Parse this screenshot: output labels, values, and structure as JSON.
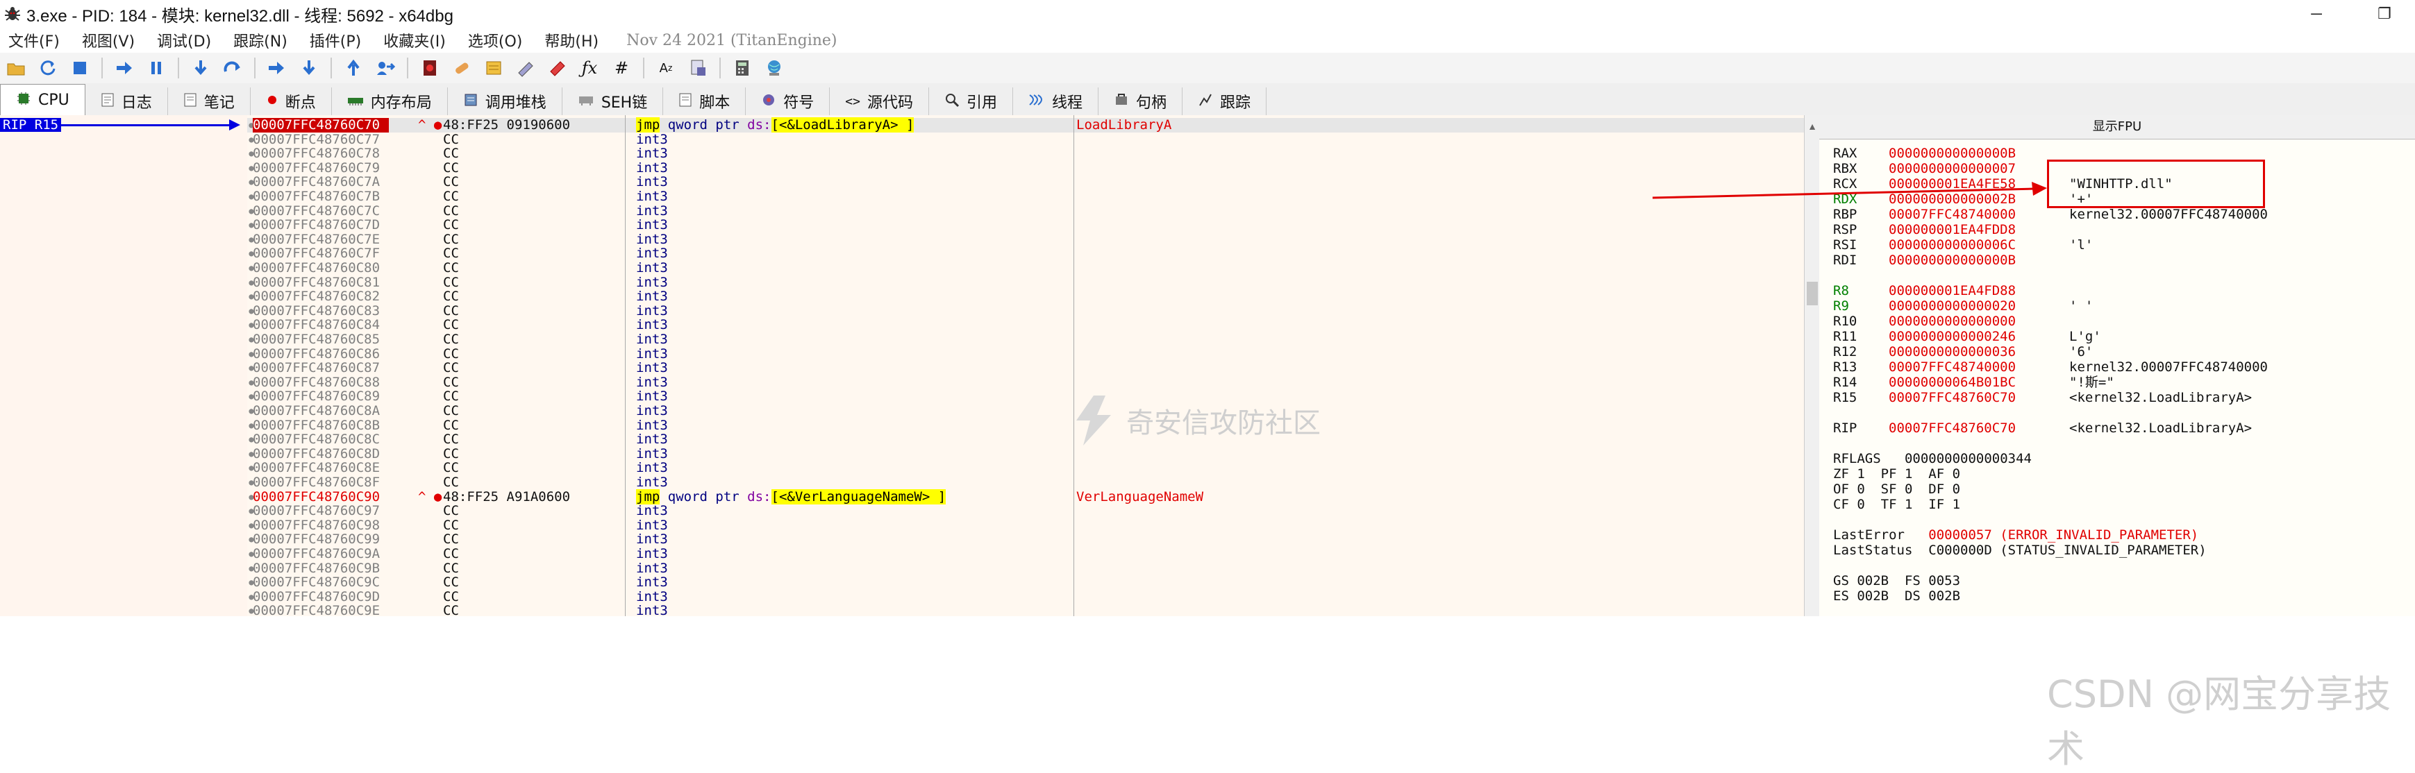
{
  "window": {
    "title": "3.exe - PID: 184 - 模块: kernel32.dll - 线程: 5692 - x64dbg",
    "controls": {
      "minimize": "─",
      "restore": "❐"
    }
  },
  "menu": {
    "items": [
      "文件(F)",
      "视图(V)",
      "调试(D)",
      "跟踪(N)",
      "插件(P)",
      "收藏夹(I)",
      "选项(O)",
      "帮助(H)"
    ],
    "build_date": "Nov 24 2021 (TitanEngine)"
  },
  "toolbar": {
    "icons": [
      "open-icon",
      "restart-icon",
      "stop-icon",
      "run-icon",
      "pause-icon",
      "step-into-icon",
      "step-over-icon",
      "trace-into-icon",
      "trace-over-icon",
      "execute-till-return-icon",
      "run-to-user-code-icon",
      "record-icon",
      "patch-icon",
      "comment-icon",
      "label-icon",
      "bookmark-icon",
      "function-icon",
      "hash-icon",
      "font-icon",
      "strings-icon",
      "calculator-icon",
      "globe-icon"
    ]
  },
  "tabs": [
    {
      "label": "CPU",
      "icon": "cpu-icon",
      "active": true
    },
    {
      "label": "日志",
      "icon": "log-icon"
    },
    {
      "label": "笔记",
      "icon": "notes-icon"
    },
    {
      "label": "断点",
      "icon": "breakpoint-icon"
    },
    {
      "label": "内存布局",
      "icon": "memory-icon"
    },
    {
      "label": "调用堆栈",
      "icon": "callstack-icon"
    },
    {
      "label": "SEH链",
      "icon": "seh-icon"
    },
    {
      "label": "脚本",
      "icon": "script-icon"
    },
    {
      "label": "符号",
      "icon": "symbols-icon"
    },
    {
      "label": "源代码",
      "icon": "source-icon"
    },
    {
      "label": "引用",
      "icon": "references-icon"
    },
    {
      "label": "线程",
      "icon": "threads-icon"
    },
    {
      "label": "句柄",
      "icon": "handles-icon"
    },
    {
      "label": "跟踪",
      "icon": "trace-icon"
    }
  ],
  "rip_label": "RIP R15",
  "disasm": [
    {
      "addr": "00007FFC48760C70",
      "mark": "^ ●",
      "bytes": "48:FF25 09190600",
      "mn": "jmp",
      "op": "qword ptr ",
      "seg": "ds:",
      "tgt": "[<&LoadLibraryA> ]",
      "cmt": "LoadLibraryA",
      "rip": true
    },
    {
      "addr": "00007FFC48760C77",
      "bytes": "CC",
      "mn": "int3"
    },
    {
      "addr": "00007FFC48760C78",
      "bytes": "CC",
      "mn": "int3"
    },
    {
      "addr": "00007FFC48760C79",
      "bytes": "CC",
      "mn": "int3"
    },
    {
      "addr": "00007FFC48760C7A",
      "bytes": "CC",
      "mn": "int3"
    },
    {
      "addr": "00007FFC48760C7B",
      "bytes": "CC",
      "mn": "int3"
    },
    {
      "addr": "00007FFC48760C7C",
      "bytes": "CC",
      "mn": "int3"
    },
    {
      "addr": "00007FFC48760C7D",
      "bytes": "CC",
      "mn": "int3"
    },
    {
      "addr": "00007FFC48760C7E",
      "bytes": "CC",
      "mn": "int3"
    },
    {
      "addr": "00007FFC48760C7F",
      "bytes": "CC",
      "mn": "int3"
    },
    {
      "addr": "00007FFC48760C80",
      "bytes": "CC",
      "mn": "int3"
    },
    {
      "addr": "00007FFC48760C81",
      "bytes": "CC",
      "mn": "int3"
    },
    {
      "addr": "00007FFC48760C82",
      "bytes": "CC",
      "mn": "int3"
    },
    {
      "addr": "00007FFC48760C83",
      "bytes": "CC",
      "mn": "int3"
    },
    {
      "addr": "00007FFC48760C84",
      "bytes": "CC",
      "mn": "int3"
    },
    {
      "addr": "00007FFC48760C85",
      "bytes": "CC",
      "mn": "int3"
    },
    {
      "addr": "00007FFC48760C86",
      "bytes": "CC",
      "mn": "int3"
    },
    {
      "addr": "00007FFC48760C87",
      "bytes": "CC",
      "mn": "int3"
    },
    {
      "addr": "00007FFC48760C88",
      "bytes": "CC",
      "mn": "int3"
    },
    {
      "addr": "00007FFC48760C89",
      "bytes": "CC",
      "mn": "int3"
    },
    {
      "addr": "00007FFC48760C8A",
      "bytes": "CC",
      "mn": "int3"
    },
    {
      "addr": "00007FFC48760C8B",
      "bytes": "CC",
      "mn": "int3"
    },
    {
      "addr": "00007FFC48760C8C",
      "bytes": "CC",
      "mn": "int3"
    },
    {
      "addr": "00007FFC48760C8D",
      "bytes": "CC",
      "mn": "int3"
    },
    {
      "addr": "00007FFC48760C8E",
      "bytes": "CC",
      "mn": "int3"
    },
    {
      "addr": "00007FFC48760C8F",
      "bytes": "CC",
      "mn": "int3"
    },
    {
      "addr": "00007FFC48760C90",
      "mark": "^ ●",
      "bytes": "48:FF25 A91A0600",
      "mn": "jmp",
      "op": "qword ptr ",
      "seg": "ds:",
      "tgt": "[<&VerLanguageNameW> ]",
      "cmt": "VerLanguageNameW",
      "red": true
    },
    {
      "addr": "00007FFC48760C97",
      "bytes": "CC",
      "mn": "int3"
    },
    {
      "addr": "00007FFC48760C98",
      "bytes": "CC",
      "mn": "int3"
    },
    {
      "addr": "00007FFC48760C99",
      "bytes": "CC",
      "mn": "int3"
    },
    {
      "addr": "00007FFC48760C9A",
      "bytes": "CC",
      "mn": "int3"
    },
    {
      "addr": "00007FFC48760C9B",
      "bytes": "CC",
      "mn": "int3"
    },
    {
      "addr": "00007FFC48760C9C",
      "bytes": "CC",
      "mn": "int3"
    },
    {
      "addr": "00007FFC48760C9D",
      "bytes": "CC",
      "mn": "int3"
    },
    {
      "addr": "00007FFC48760C9E",
      "bytes": "CC",
      "mn": "int3"
    }
  ],
  "registers": {
    "header": "显示FPU",
    "general": [
      {
        "name": "RAX",
        "value": "000000000000000B",
        "comment": ""
      },
      {
        "name": "RBX",
        "value": "0000000000000007",
        "comment": ""
      },
      {
        "name": "RCX",
        "value": "000000001EA4FE58",
        "comment": "\"WINHTTP.dll\""
      },
      {
        "name": "RDX",
        "value": "000000000000002B",
        "comment": "'+'",
        "green": true
      },
      {
        "name": "RBP",
        "value": "00007FFC48740000",
        "comment": "kernel32.00007FFC48740000"
      },
      {
        "name": "RSP",
        "value": "000000001EA4FDD8",
        "comment": ""
      },
      {
        "name": "RSI",
        "value": "000000000000006C",
        "comment": "'l'"
      },
      {
        "name": "RDI",
        "value": "000000000000000B",
        "comment": ""
      }
    ],
    "extended": [
      {
        "name": "R8",
        "value": "000000001EA4FD88",
        "comment": "",
        "green": true
      },
      {
        "name": "R9",
        "value": "0000000000000020",
        "comment": "' '",
        "green": true
      },
      {
        "name": "R10",
        "value": "0000000000000000",
        "comment": ""
      },
      {
        "name": "R11",
        "value": "0000000000000246",
        "comment": "L'g'"
      },
      {
        "name": "R12",
        "value": "0000000000000036",
        "comment": "'6'"
      },
      {
        "name": "R13",
        "value": "00007FFC48740000",
        "comment": "kernel32.00007FFC48740000"
      },
      {
        "name": "R14",
        "value": "00000000064B01BC",
        "comment": "\"!斯=\""
      },
      {
        "name": "R15",
        "value": "00007FFC48760C70",
        "comment": "<kernel32.LoadLibraryA>"
      }
    ],
    "rip": {
      "name": "RIP",
      "value": "00007FFC48760C70",
      "comment": "<kernel32.LoadLibraryA>"
    },
    "rflags": "RFLAGS   0000000000000344",
    "flags": [
      "ZF 1  PF 1  AF 0",
      "OF 0  SF 0  DF 0",
      "CF 0  TF 1  IF 1"
    ],
    "lasterror_label": "LastError",
    "lasterror_value": "00000057 (ERROR_INVALID_PARAMETER)",
    "laststatus_label": "LastStatus",
    "laststatus_value": "C000000D (STATUS_INVALID_PARAMETER)",
    "seg1": "GS 002B  FS 0053",
    "seg2": "ES 002B  DS 002B"
  },
  "watermarks": {
    "center": "奇安信攻防社区",
    "corner": "CSDN @网宝分享技术"
  }
}
